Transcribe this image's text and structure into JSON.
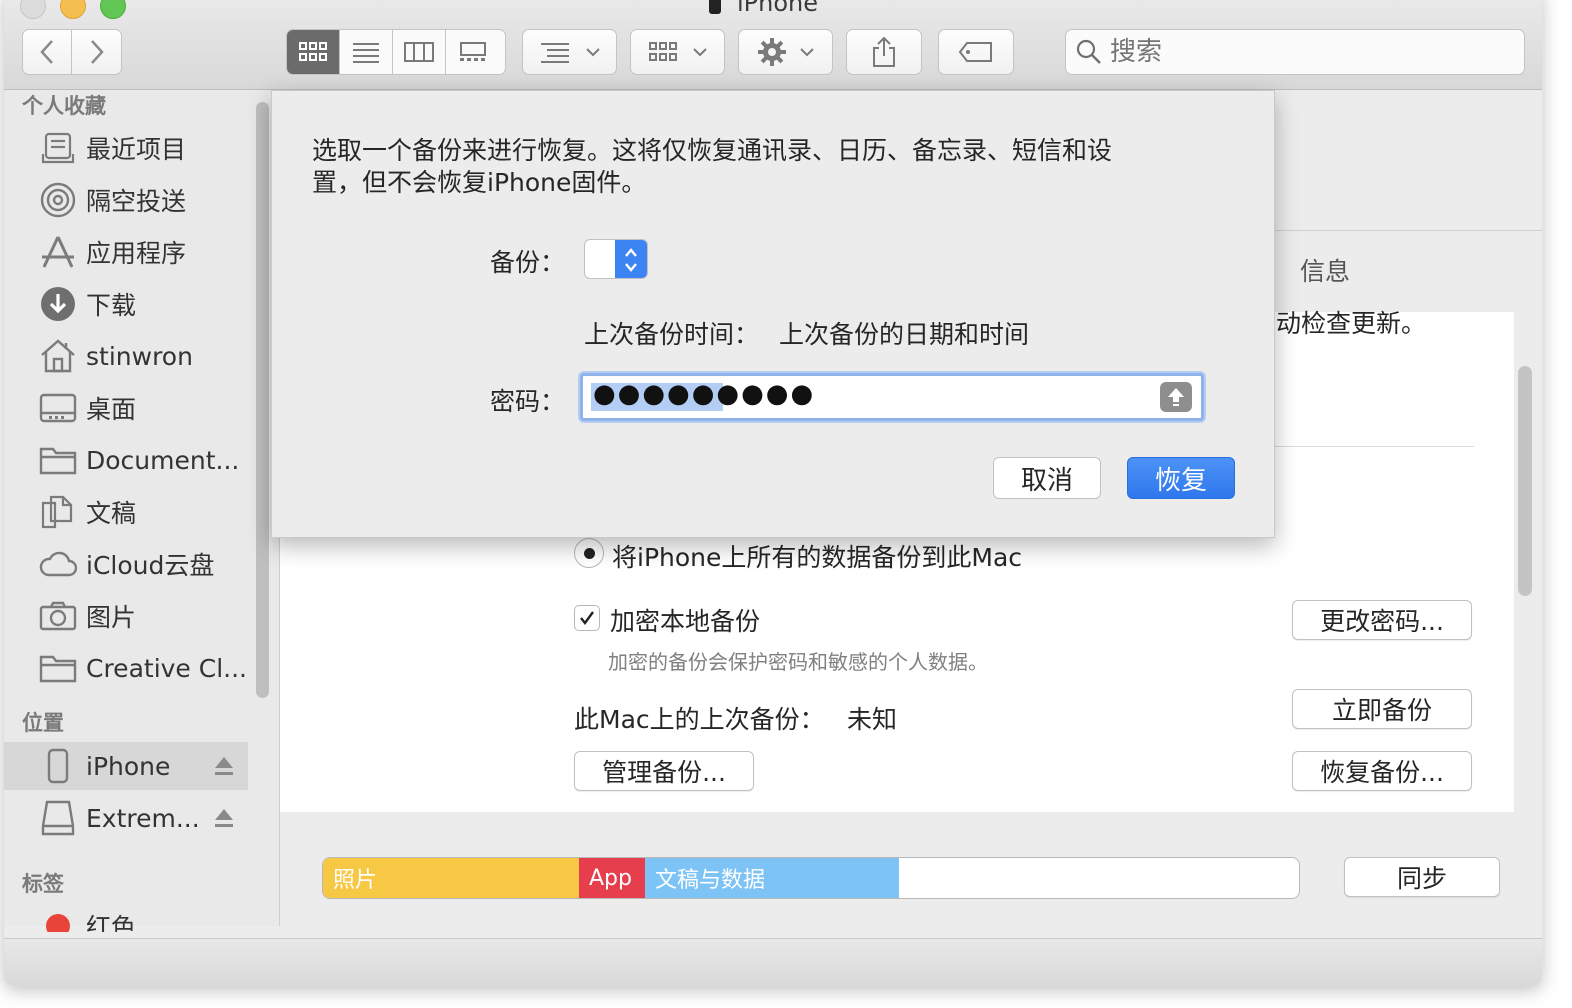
{
  "window": {
    "title": "iPhone"
  },
  "toolbar": {
    "back_icon": "chevron-left-icon",
    "forward_icon": "chevron-right-icon",
    "search_placeholder": "搜索"
  },
  "sidebar": {
    "favorites_header": "个人收藏",
    "favorites": [
      {
        "label": "最近项目",
        "icon": "recents-icon"
      },
      {
        "label": "隔空投送",
        "icon": "airdrop-icon"
      },
      {
        "label": "应用程序",
        "icon": "applications-icon"
      },
      {
        "label": "下载",
        "icon": "downloads-icon"
      },
      {
        "label": "stinwron",
        "icon": "home-icon"
      },
      {
        "label": "桌面",
        "icon": "desktop-icon"
      },
      {
        "label": "Document...",
        "icon": "folder-icon"
      },
      {
        "label": "文稿",
        "icon": "documents-icon"
      },
      {
        "label": "iCloud云盘",
        "icon": "icloud-icon"
      },
      {
        "label": "图片",
        "icon": "camera-icon"
      },
      {
        "label": "Creative Cl...",
        "icon": "folder-icon"
      }
    ],
    "locations_header": "位置",
    "locations": [
      {
        "label": "iPhone",
        "icon": "iphone-icon",
        "selected": true
      },
      {
        "label": "Extrem...",
        "icon": "drive-icon",
        "selected": false
      }
    ],
    "tags_header": "标签",
    "tags": [
      {
        "label": "红色",
        "color": "#e9443a"
      }
    ]
  },
  "main": {
    "tab_info": "信息",
    "update_text_fragment": "动检查更新。",
    "backup_radio_label": "将iPhone上所有的数据备份到此Mac",
    "encrypt_checkbox_label": "加密本地备份",
    "encrypt_hint": "加密的备份会保护密码和敏感的个人数据。",
    "last_backup_label": "此Mac上的上次备份：",
    "last_backup_value": "未知",
    "change_password_button": "更改密码...",
    "backup_now_button": "立即备份",
    "manage_backups_button": "管理备份...",
    "restore_backup_button": "恢复备份...",
    "sync_button": "同步",
    "storage": [
      {
        "label": "照片",
        "fraction": 0.262,
        "color": "#f6c844"
      },
      {
        "label": "App",
        "fraction": 0.067,
        "color": "#e63e4d"
      },
      {
        "label": "文稿与数据",
        "fraction": 0.26,
        "color": "#7ec3f6"
      }
    ]
  },
  "sheet": {
    "message_line1": "选取一个备份来进行恢复。这将仅恢复通讯录、日历、备忘录、短信和设",
    "message_line2": "置，但不会恢复iPhone固件。",
    "backup_label": "备份：",
    "backup_value": "",
    "last_backup_time_label": "上次备份时间：",
    "last_backup_time_value": "上次备份的日期和时间",
    "password_label": "密码：",
    "password_value": "●●●●●●●●●",
    "cancel_button": "取消",
    "restore_button": "恢复",
    "accent_color": "#3c84f3"
  }
}
